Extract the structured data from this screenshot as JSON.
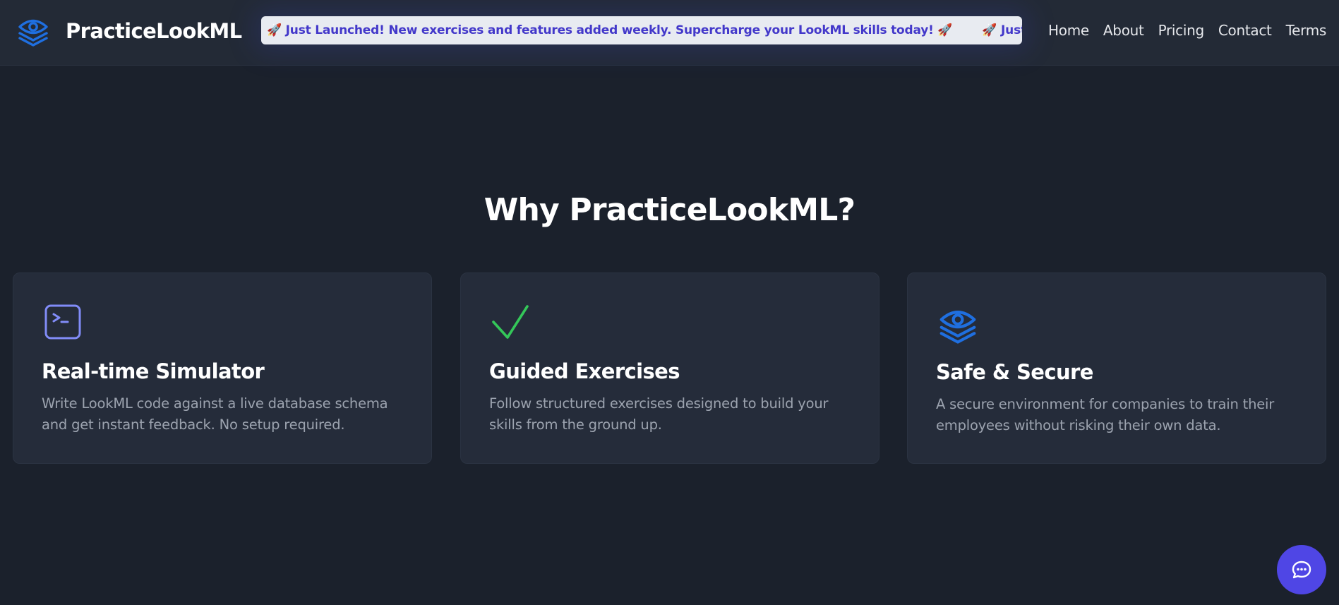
{
  "brand": {
    "name": "PracticeLookML",
    "icon": "layered-eye-icon",
    "color": "#1f6fe0"
  },
  "ticker": {
    "items": [
      "🚀 Just Launched! New exercises and features added weekly. Supercharge your LookML skills today! 🚀",
      "🚀 Just Launched! New exercises and features added weekly. Supercharge your LookML skills today! 🚀"
    ],
    "text_color": "#4338ca",
    "background": "#e8ebf1"
  },
  "nav": {
    "items": [
      "Home",
      "About",
      "Pricing",
      "Contact",
      "Terms"
    ]
  },
  "section": {
    "title": "Why PracticeLookML?"
  },
  "features": [
    {
      "icon": "terminal-icon",
      "icon_color": "#818cf8",
      "title": "Real-time Simulator",
      "description": "Write LookML code against a live database schema and get instant feedback. No setup required."
    },
    {
      "icon": "checkmark-icon",
      "icon_color": "#34c759",
      "title": "Guided Exercises",
      "description": "Follow structured exercises designed to build your skills from the ground up."
    },
    {
      "icon": "layered-eye-icon",
      "icon_color": "#1f6fe0",
      "title": "Safe & Secure",
      "description": "A secure environment for companies to train their employees without risking their own data."
    }
  ],
  "chat": {
    "icon": "chat-bubble-icon",
    "color": "#4f46e5"
  },
  "colors": {
    "page_background": "#1b212c",
    "header_background": "#232a36",
    "card_background": "#252c3a"
  }
}
